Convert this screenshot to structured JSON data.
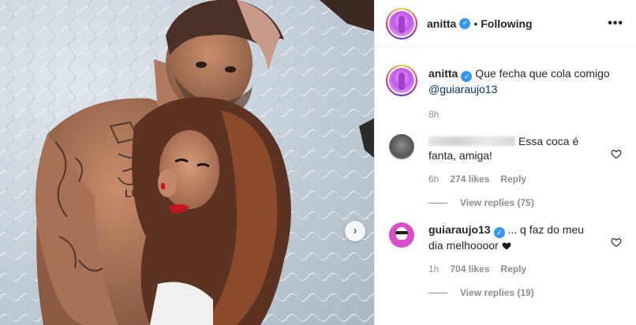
{
  "header": {
    "username": "anitta",
    "separator": "•",
    "follow_state": "Following",
    "more_icon": "more-horizontal-icon",
    "more_label": "•••"
  },
  "caption": {
    "username": "anitta",
    "text": "Que fecha que cola comigo",
    "mention": "@guiaraujo13",
    "time": "8h"
  },
  "comments": [
    {
      "username_visible": false,
      "text": "Essa coca é fanta, amiga!",
      "time": "6h",
      "likes": "274 likes",
      "reply": "Reply",
      "view_replies": "View replies (75)"
    },
    {
      "username": "guiaraujo13",
      "verified": true,
      "text": "... q faz do meu dia melhoooor",
      "emoji": "black-heart-icon",
      "time": "1h",
      "likes": "704 likes",
      "reply": "Reply",
      "view_replies": "View replies (19)"
    }
  ],
  "media": {
    "next_button_icon": "chevron-right-icon",
    "next_button_glyph": "›"
  },
  "colors": {
    "verified": "#3897f0",
    "secondary_text": "#8e8e8e",
    "mention": "#00376b",
    "border": "#efefef"
  }
}
